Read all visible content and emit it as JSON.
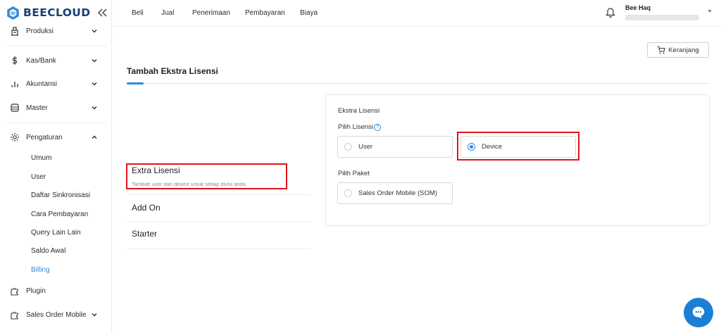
{
  "brand": {
    "name": "BEECLOUD"
  },
  "sidebar": {
    "items": [
      {
        "label": "Produksi",
        "icon": "factory-icon"
      },
      {
        "label": "Kas/Bank",
        "icon": "dollar-icon"
      },
      {
        "label": "Akuntansi",
        "icon": "bar-chart-icon"
      },
      {
        "label": "Master",
        "icon": "database-icon"
      },
      {
        "label": "Pengaturan",
        "icon": "gear-icon"
      },
      {
        "label": "Plugin",
        "icon": "puzzle-icon"
      },
      {
        "label": "Sales Order Mobile",
        "icon": "puzzle-icon"
      }
    ],
    "pengaturan_sub": [
      "Umum",
      "User",
      "Daftar Sinkronisasi",
      "Cara Pembayaran",
      "Query Lain Lain",
      "Saldo Awal",
      "Billing"
    ],
    "active_sub": "Billing"
  },
  "topnav": [
    "Beli",
    "Jual",
    "Penerimaan",
    "Pembayaran",
    "Biaya"
  ],
  "user": {
    "name": "Bee Haq"
  },
  "cart": {
    "label": "Keranjang"
  },
  "page": {
    "title": "Tambah Ekstra Lisensi"
  },
  "options": [
    {
      "title": "Extra Lisensi",
      "desc": "Tambah user dan device untuk setiap divisi anda"
    },
    {
      "title": "Add On"
    },
    {
      "title": "Starter"
    }
  ],
  "form": {
    "section_title": "Ekstra Lisensi",
    "pilih_lisensi_label": "Pilih Lisensi",
    "lisensi_options": [
      {
        "label": "User",
        "selected": false
      },
      {
        "label": "Device",
        "selected": true
      }
    ],
    "pilih_paket_label": "Pilih Paket",
    "paket_options": [
      {
        "label": "Sales Order Mobile (SOM)",
        "selected": false
      }
    ]
  },
  "colors": {
    "accent": "#2e8bdc",
    "brand_dark": "#1b3f73",
    "highlight": "#e0141b",
    "fab": "#1c7fd6"
  }
}
